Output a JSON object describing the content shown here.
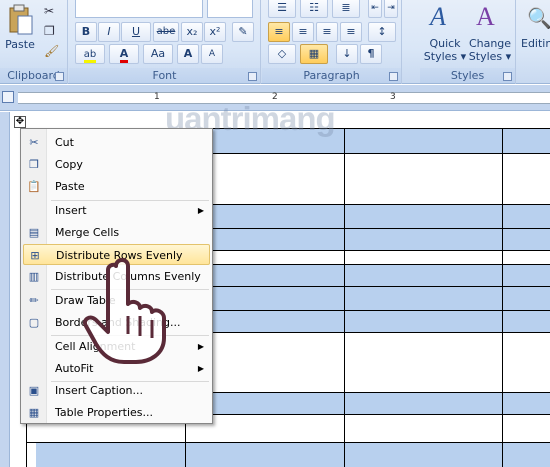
{
  "ribbon": {
    "clipboard": {
      "paste_label": "Paste",
      "group_label": "Clipboard"
    },
    "font": {
      "group_label": "Font",
      "buttons": [
        "B",
        "I",
        "U",
        "abe",
        "x₂",
        "x²",
        "Aa"
      ]
    },
    "paragraph": {
      "group_label": "Paragraph"
    },
    "styles": {
      "quick_styles_line1": "Quick",
      "quick_styles_line2": "Styles",
      "change_styles_line1": "Change",
      "change_styles_line2": "Styles",
      "group_label": "Styles"
    },
    "editing": {
      "label": "Editin"
    }
  },
  "ruler": {
    "marks": [
      "1",
      "2",
      "3"
    ]
  },
  "watermark": {
    "text": "uantrimang"
  },
  "context_menu": {
    "items": [
      {
        "label": "Cut",
        "icon": "scissors-icon",
        "submenu": false
      },
      {
        "label": "Copy",
        "icon": "copy-icon",
        "submenu": false
      },
      {
        "label": "Paste",
        "icon": "paste-icon",
        "submenu": false
      },
      {
        "label": "Insert",
        "icon": "",
        "submenu": true
      },
      {
        "label": "Merge Cells",
        "icon": "merge-cells-icon",
        "submenu": false
      },
      {
        "label": "Distribute Rows Evenly",
        "icon": "distribute-rows-icon",
        "submenu": false,
        "highlighted": true
      },
      {
        "label": "Distribute Columns Evenly",
        "icon": "distribute-columns-icon",
        "submenu": false
      },
      {
        "label": "Draw Table",
        "icon": "pencil-icon",
        "submenu": false
      },
      {
        "label": "Borders and Shading...",
        "icon": "borders-icon",
        "submenu": false
      },
      {
        "label": "Cell Alignment",
        "icon": "",
        "submenu": true
      },
      {
        "label": "AutoFit",
        "icon": "",
        "submenu": true
      },
      {
        "label": "Insert Caption...",
        "icon": "caption-icon",
        "submenu": false
      },
      {
        "label": "Table Properties...",
        "icon": "table-properties-icon",
        "submenu": false
      }
    ]
  },
  "colors": {
    "accent_highlight": "#ffe59a",
    "table_band": "#b8d0ee"
  }
}
